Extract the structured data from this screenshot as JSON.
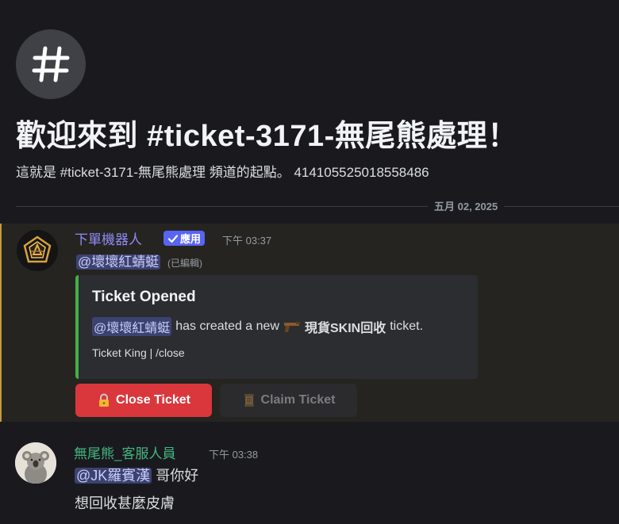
{
  "channel": {
    "icon": "hash-icon",
    "welcome_title": "歡迎來到 #ticket-3171-無尾熊處理！",
    "welcome_subtitle": "這就是 #ticket-3171-無尾熊處理 頻道的起點。 414105525018558486"
  },
  "date_divider": "五月 02, 2025",
  "bot_message": {
    "author": "下單機器人",
    "badge": "應用",
    "timestamp": "下午 03:37",
    "mention": "@壞壞紅蜻蜓",
    "edited": "(已編輯)",
    "highlight_color": "#c59a3c",
    "embed": {
      "accent_color": "#43b047",
      "title": "Ticket Opened",
      "mention": "@壞壞紅蜻蜓",
      "text_before": "has created a new",
      "emoji": "gun-icon",
      "category": "現貨SKIN回收",
      "text_after": "ticket.",
      "footer": "Ticket King | /close"
    },
    "buttons": [
      {
        "label": "Close Ticket",
        "icon": "lock-icon",
        "color": "#da373c",
        "enabled": true
      },
      {
        "label": "Claim Ticket",
        "icon": "scroll-icon",
        "color": "#2b2b2d",
        "enabled": false
      }
    ]
  },
  "user_message": {
    "author": "無尾熊_客服人員",
    "author_color": "#43b581",
    "timestamp": "下午 03:38",
    "mention": "@JK羅賓漢",
    "text1": "哥你好",
    "text2": "想回收甚麼皮膚"
  }
}
